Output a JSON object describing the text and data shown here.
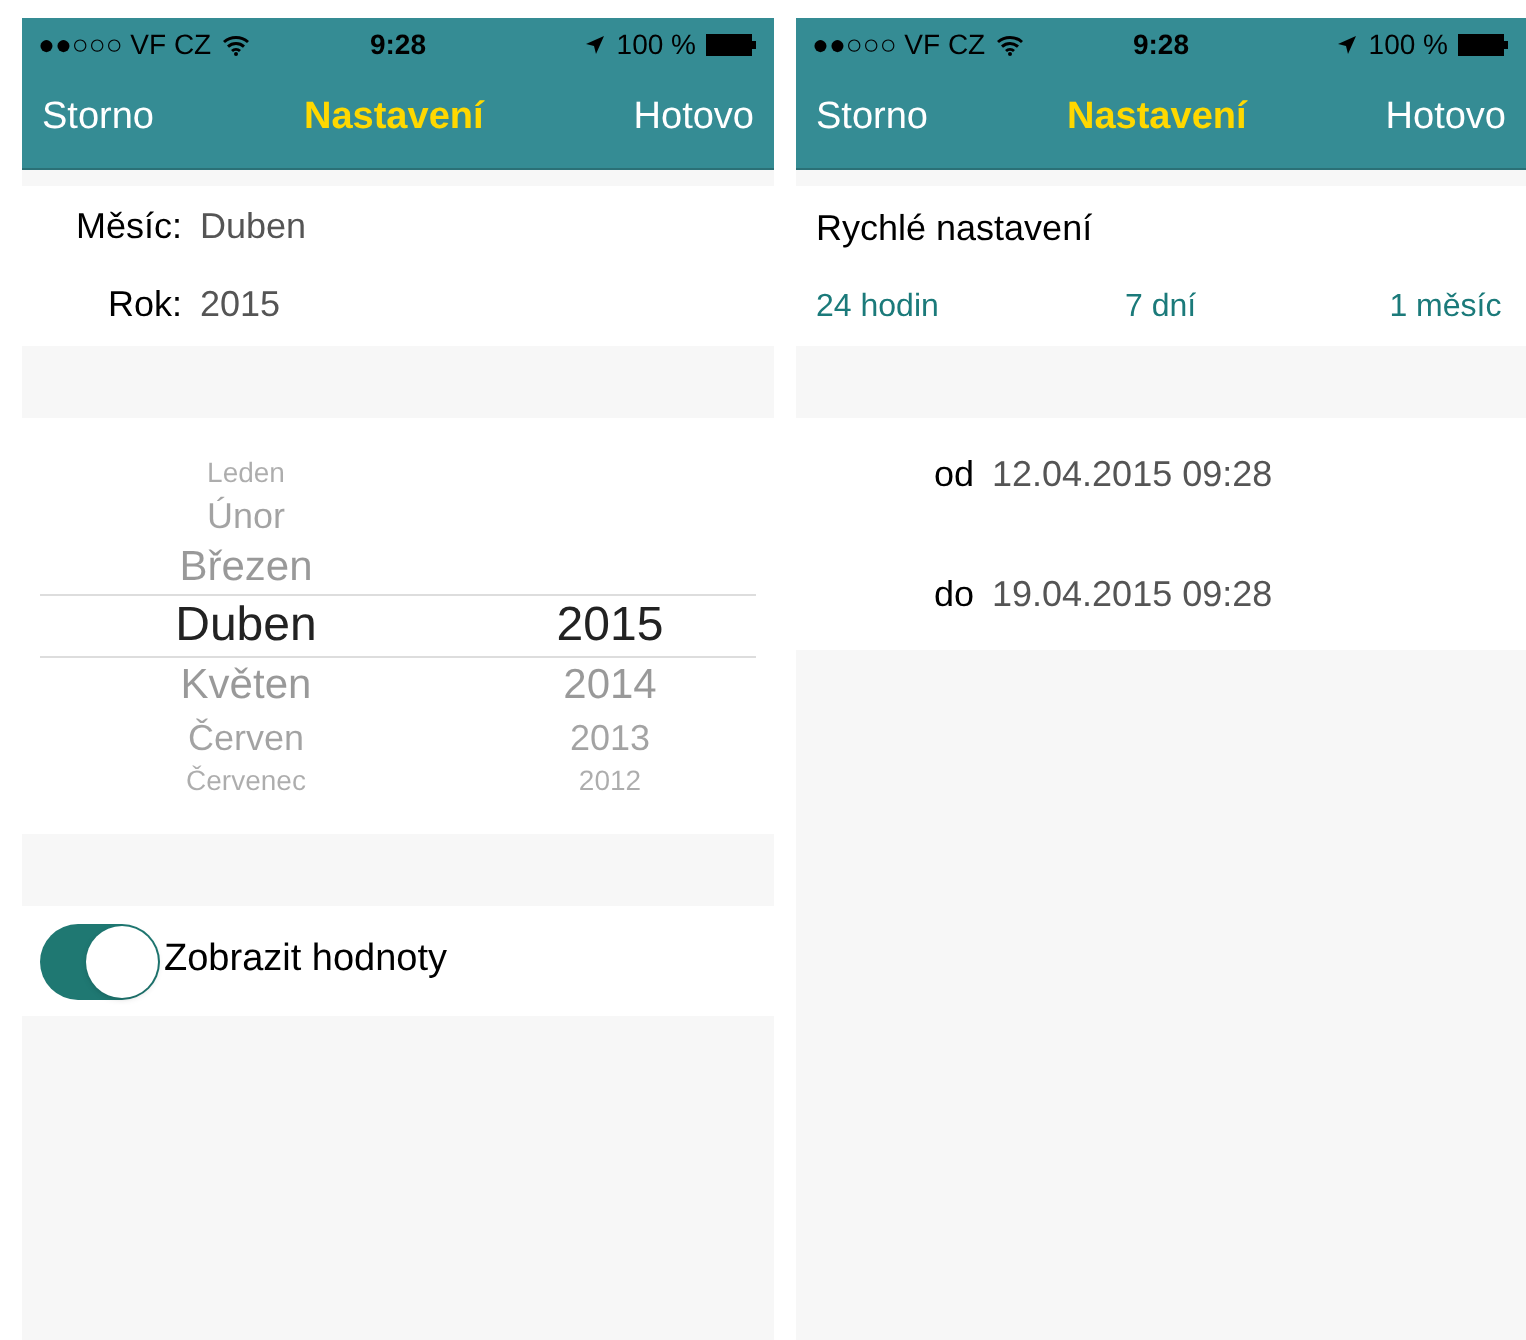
{
  "screens": [
    {
      "kind": "month_picker",
      "status_bar": {
        "carrier": "●●○○○ VF CZ",
        "time": "9:28",
        "battery": "100 %"
      },
      "nav": {
        "left": "Storno",
        "title": "Nastavení",
        "right": "Hotovo"
      },
      "fields": [
        {
          "label": "Měsíc:",
          "value": "Duben"
        },
        {
          "label": "Rok:",
          "value": "2015"
        }
      ],
      "picker": {
        "columns": [
          {
            "items": [
              {
                "label": "Leden",
                "selected": false
              },
              {
                "label": "Únor",
                "selected": false
              },
              {
                "label": "Březen",
                "selected": false
              },
              {
                "label": "Duben",
                "selected": true
              },
              {
                "label": "Květen",
                "selected": false
              },
              {
                "label": "Červen",
                "selected": false
              },
              {
                "label": "Červenec",
                "selected": false
              }
            ]
          },
          {
            "items": [
              {
                "label": "2015",
                "selected": true
              },
              {
                "label": "2014",
                "selected": false
              },
              {
                "label": "2013",
                "selected": false
              },
              {
                "label": "2012",
                "selected": false
              }
            ]
          }
        ]
      },
      "toggle": {
        "label": "Zobrazit hodnoty",
        "on": true
      }
    },
    {
      "kind": "range",
      "status_bar": {
        "carrier": "●●○○○ VF CZ",
        "time": "9:28",
        "battery": "100 %"
      },
      "nav": {
        "left": "Storno",
        "title": "Nastavení",
        "right": "Hotovo"
      },
      "quick": {
        "title": "Rychlé nastavení",
        "options": [
          "24 hodin",
          "7 dní",
          "1 měsíc"
        ]
      },
      "range": [
        {
          "label": "od",
          "value": "12.04.2015 09:28"
        },
        {
          "label": "do",
          "value": "19.04.2015 09:28"
        }
      ]
    }
  ]
}
